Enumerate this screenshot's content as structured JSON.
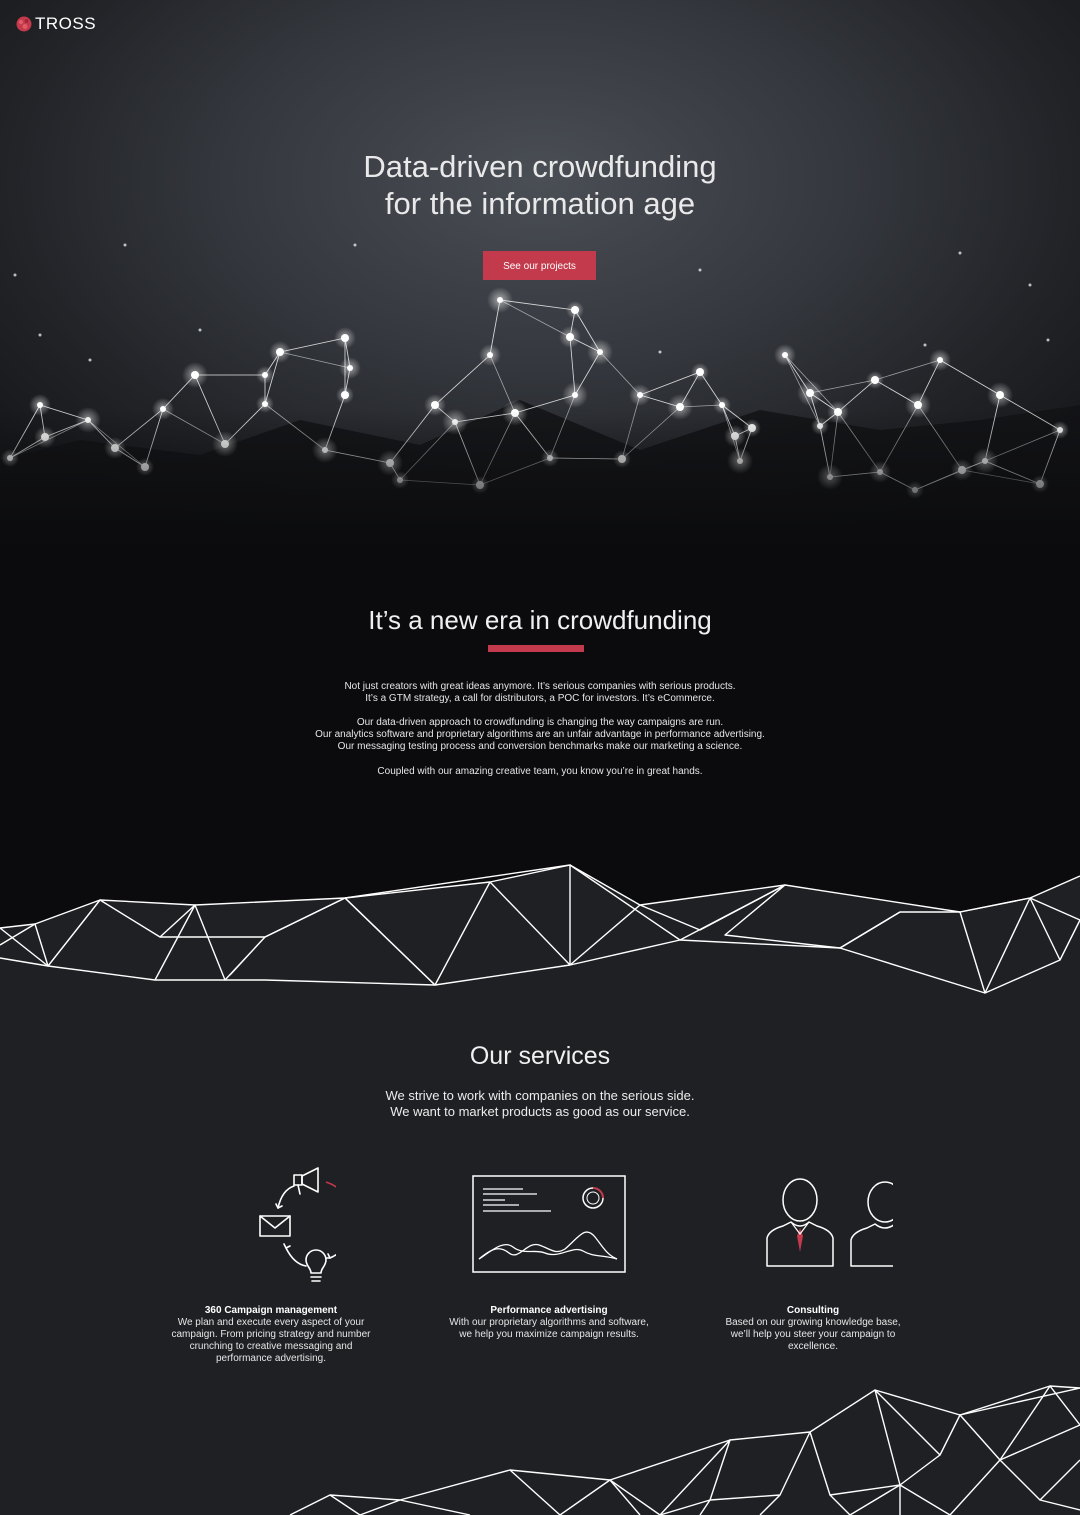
{
  "brand": {
    "name": "TROSS",
    "accent": "#c23a4b"
  },
  "hero": {
    "title_line1": "Data-driven crowdfunding",
    "title_line2": "for the information age",
    "cta_label": "See our projects"
  },
  "era": {
    "heading": "It’s a new era in crowdfunding",
    "p1_l1": "Not just creators with great ideas anymore. It’s serious companies with serious products.",
    "p1_l2": "It’s a GTM strategy, a call for distributors, a POC for investors. It’s eCommerce.",
    "p2_l1": "Our data-driven approach to crowdfunding is changing the way campaigns are run.",
    "p2_l2": "Our analytics software and proprietary algorithms are an unfair advantage in performance advertising.",
    "p2_l3": "Our messaging testing process and conversion benchmarks make our marketing a science.",
    "p3_l1": "Coupled with our amazing creative team, you know you’re in great hands."
  },
  "services": {
    "title": "Our services",
    "sub_l1": "We strive to work with companies on the serious side.",
    "sub_l2": "We want to market products as good as our service.",
    "items": [
      {
        "icon": "campaign-cycle-icon",
        "name": "360 Campaign management",
        "desc_l1": "We plan and execute every aspect of your",
        "desc_l2": "campaign. From pricing strategy and number",
        "desc_l3": "crunching to creative messaging and",
        "desc_l4": "performance advertising."
      },
      {
        "icon": "analytics-dashboard-icon",
        "name": "Performance advertising",
        "desc_l1": "With our proprietary algorithms and software,",
        "desc_l2": "we help you maximize campaign results."
      },
      {
        "icon": "people-icon",
        "name": "Consulting",
        "desc_l1": "Based on our growing knowledge base,",
        "desc_l2": "we’ll help you steer your campaign to",
        "desc_l3": "excellence."
      }
    ]
  }
}
